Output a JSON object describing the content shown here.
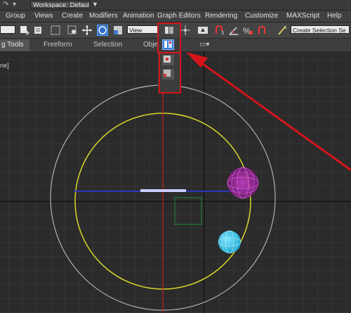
{
  "title_bar": {
    "workspace_label": "Workspace: Default",
    "icons": [
      "redo-icon",
      "undo-icon",
      "workspace-dropdown-arrow-icon"
    ]
  },
  "menu": {
    "items": [
      "Group",
      "Views",
      "Create",
      "Modifiers",
      "Animation",
      "Graph Editors",
      "Rendering",
      "Customize",
      "MAXScript",
      "Help"
    ]
  },
  "toolbar": {
    "view_dropdown": "View",
    "selection_set_dropdown": "Create Selection Se"
  },
  "ribbon": {
    "tabs": [
      "g Tools",
      "Freeform",
      "Selection",
      "Obje"
    ],
    "active_tab": "g Tools"
  },
  "viewport": {
    "label": "ne]",
    "grid": true
  },
  "colors": {
    "highlight_red": "#d4141a",
    "orbit_yellow": "#d9d92a",
    "outer_circle": "#b0b0b0",
    "sphere_magenta": "#c01fc0",
    "sphere_cyan": "#3cc9e8",
    "axis_blue": "#2a36b8",
    "box_green": "#1e7a3c",
    "selected_blue": "#3b7ad8"
  }
}
